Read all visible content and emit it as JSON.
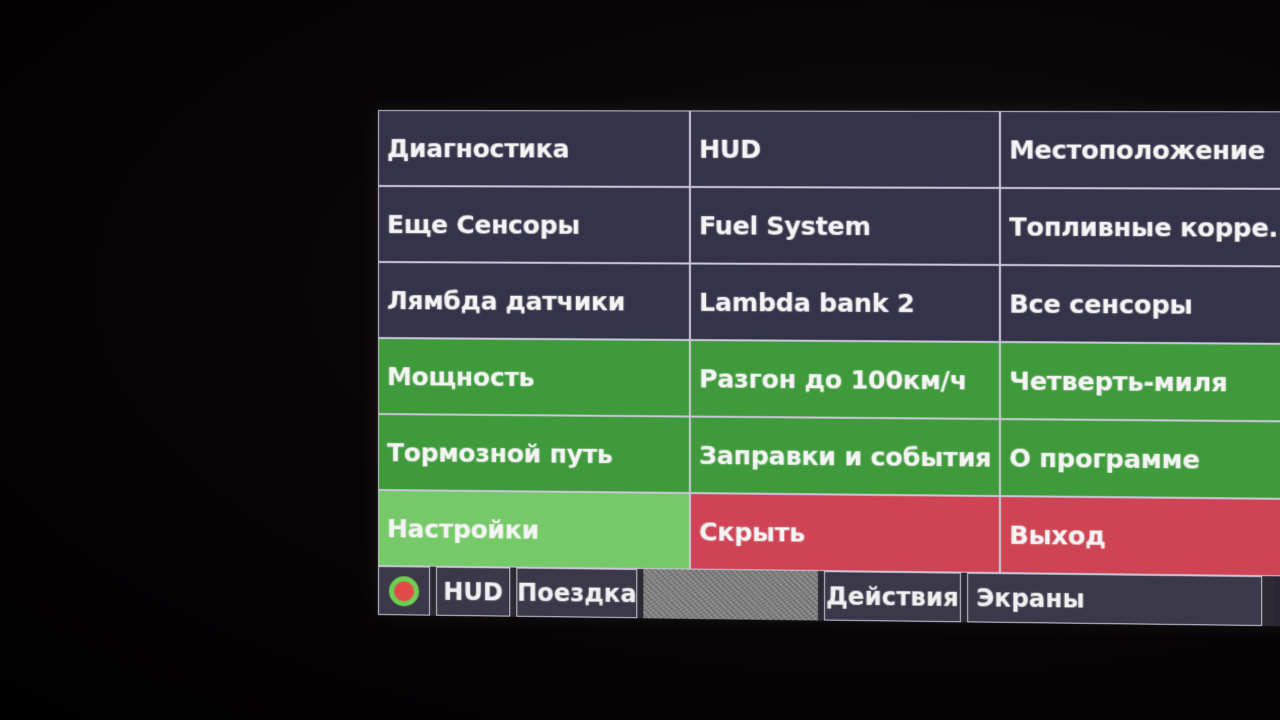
{
  "menu": {
    "tiles": [
      {
        "label": "Диагностика",
        "color": "dark"
      },
      {
        "label": "HUD",
        "color": "dark"
      },
      {
        "label": "Местоположение",
        "color": "dark"
      },
      {
        "label": "Еще Сенсоры",
        "color": "dark"
      },
      {
        "label": "Fuel System",
        "color": "dark"
      },
      {
        "label": "Топливные корре..",
        "color": "dark"
      },
      {
        "label": "Лямбда датчики",
        "color": "dark"
      },
      {
        "label": "Lambda bank 2",
        "color": "dark"
      },
      {
        "label": "Все сенсоры",
        "color": "dark"
      },
      {
        "label": "Мощность",
        "color": "green"
      },
      {
        "label": "Разгон до 100км/ч",
        "color": "green"
      },
      {
        "label": "Четверть-миля",
        "color": "green"
      },
      {
        "label": "Тормозной путь",
        "color": "green"
      },
      {
        "label": "Заправки и события",
        "color": "green"
      },
      {
        "label": "О программе",
        "color": "green"
      },
      {
        "label": "Настройки",
        "color": "light-green"
      },
      {
        "label": "Скрыть",
        "color": "red"
      },
      {
        "label": "Выход",
        "color": "red"
      }
    ]
  },
  "bottom_bar": {
    "status_icon": "status-dot-icon",
    "hud": "HUD",
    "trip": "Поездка",
    "actions": "Действия",
    "screens": "Экраны"
  },
  "colors": {
    "dark": "#35334a",
    "green": "#3f9a3c",
    "light_green": "#76c968",
    "red": "#cf4454",
    "border": "#c9c7d8"
  }
}
